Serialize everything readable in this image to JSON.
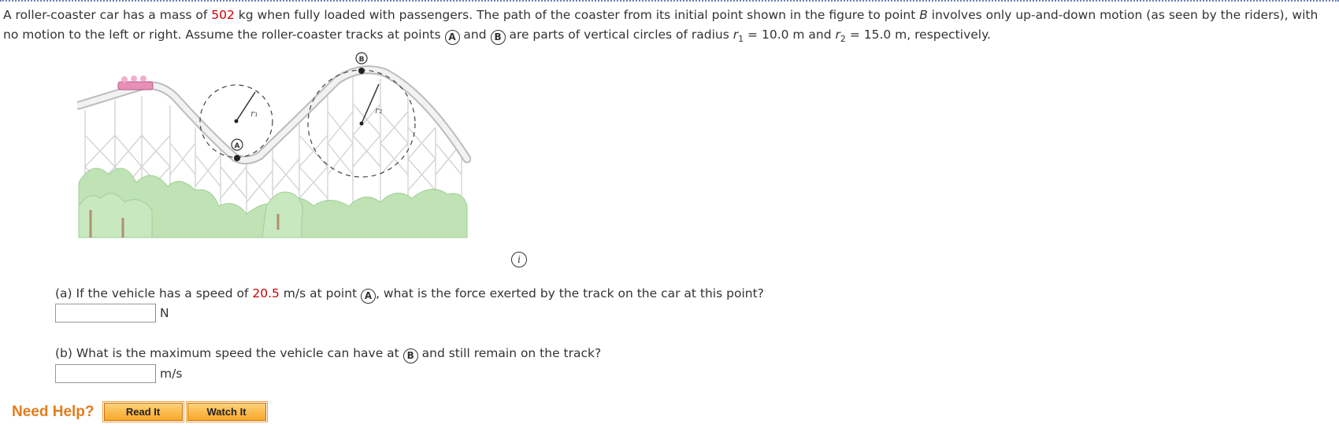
{
  "problem": {
    "t1": "A roller-coaster car has a mass of ",
    "mass": "502",
    "t2": " kg when fully loaded with passengers. The path of the coaster from its initial point shown in the figure to point ",
    "pointB": "B",
    "t3": " involves only up-and-down motion (as seen by the riders), with no motion to the left or right. Assume the roller-coaster tracks at points ",
    "markA": "A",
    "t4": " and ",
    "markB": "B",
    "t5": " are parts of vertical circles of radius ",
    "r": "r",
    "sub1": "1",
    "t6": " = 10.0 m and ",
    "sub2": "2",
    "t7": " = 15.0 m, respectively."
  },
  "figure": {
    "label_A": "A",
    "label_B": "B",
    "label_r1": "r1",
    "label_r2": "r2",
    "track_color": "#d8d8d8",
    "tree_color": "#b9dfb0",
    "car_color": "#e88fb8"
  },
  "info_icon": "i",
  "part_a": {
    "t1": "(a) If the vehicle has a speed of ",
    "speed": "20.5",
    "t2": " m/s at point ",
    "mark": "A",
    "t3": ", what is the force exerted by the track on the car at this point?",
    "unit": "N",
    "value": ""
  },
  "part_b": {
    "t1": "(b) What is the maximum speed the vehicle can have at ",
    "mark": "B",
    "t2": " and still remain on the track?",
    "unit": "m/s",
    "value": ""
  },
  "help": {
    "label": "Need Help?",
    "read": "Read It",
    "watch": "Watch It"
  },
  "colors": {
    "accent_red": "#cc0000",
    "help_orange": "#e37c1e"
  }
}
